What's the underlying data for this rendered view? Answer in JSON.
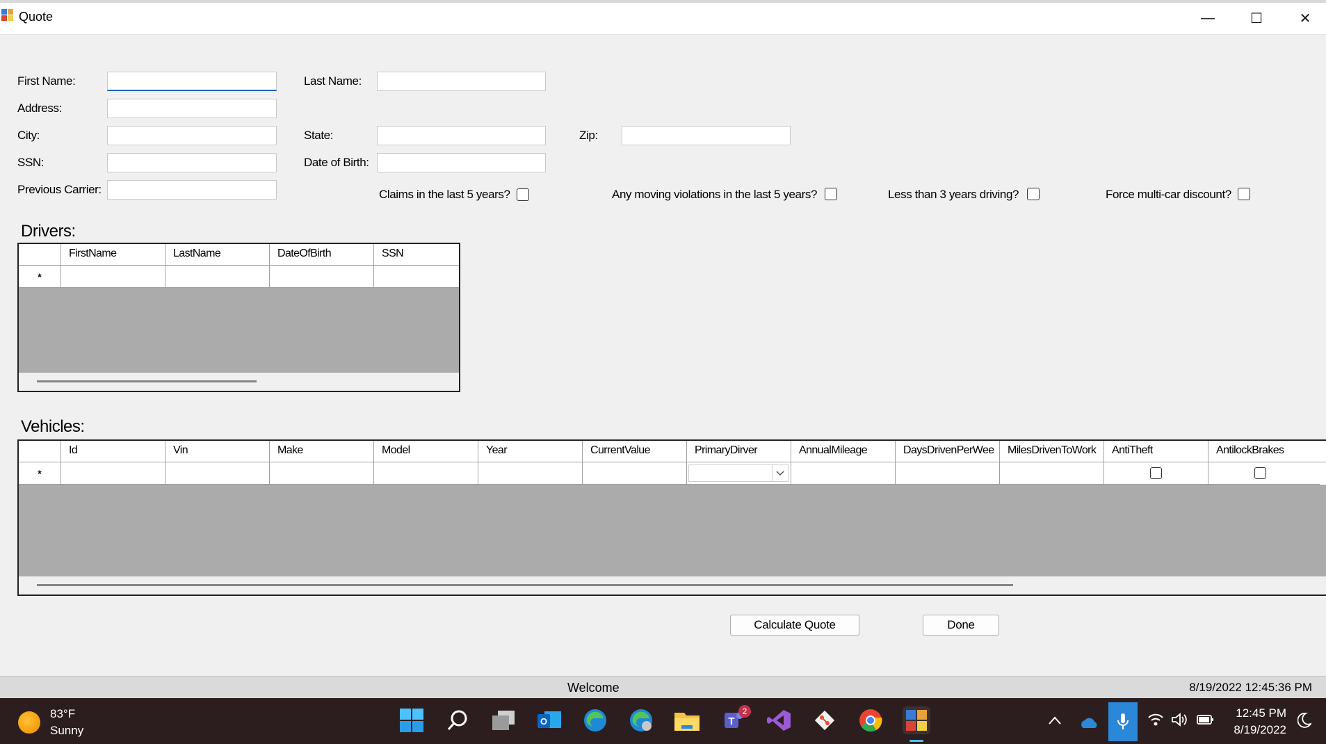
{
  "window": {
    "title": "Quote",
    "min": "—",
    "max": "☐",
    "close": "✕"
  },
  "form": {
    "first_name_label": "First Name:",
    "last_name_label": "Last Name:",
    "address_label": "Address:",
    "city_label": "City:",
    "state_label": "State:",
    "zip_label": "Zip:",
    "ssn_label": "SSN:",
    "dob_label": "Date of Birth:",
    "prev_carrier_label": "Previous Carrier:",
    "first_name": "",
    "last_name": "",
    "address": "",
    "city": "",
    "state": "",
    "zip": "",
    "ssn": "",
    "dob": "",
    "prev_carrier": ""
  },
  "checks": {
    "claims": {
      "label": "Claims in the last 5 years?",
      "checked": false
    },
    "violations": {
      "label": "Any moving violations in the last 5 years?",
      "checked": false
    },
    "less3": {
      "label": "Less than 3 years driving?",
      "checked": false
    },
    "multicar": {
      "label": "Force multi-car discount?",
      "checked": false
    }
  },
  "drivers": {
    "title": "Drivers:",
    "columns": [
      "FirstName",
      "LastName",
      "DateOfBirth",
      "SSN"
    ],
    "new_row_marker": "*"
  },
  "vehicles": {
    "title": "Vehicles:",
    "columns": [
      "Id",
      "Vin",
      "Make",
      "Model",
      "Year",
      "CurrentValue",
      "PrimaryDirver",
      "AnnualMileage",
      "DaysDrivenPerWee",
      "MilesDrivenToWork",
      "AntiTheft",
      "AntilockBrakes"
    ],
    "new_row_marker": "*"
  },
  "buttons": {
    "calculate": "Calculate Quote",
    "done": "Done"
  },
  "status": {
    "message": "Welcome",
    "datetime": "8/19/2022 12:45:36 PM"
  },
  "taskbar": {
    "weather_temp": "83°F",
    "weather_desc": "Sunny",
    "clock_time": "12:45 PM",
    "clock_date": "8/19/2022",
    "teams_badge": "2"
  }
}
